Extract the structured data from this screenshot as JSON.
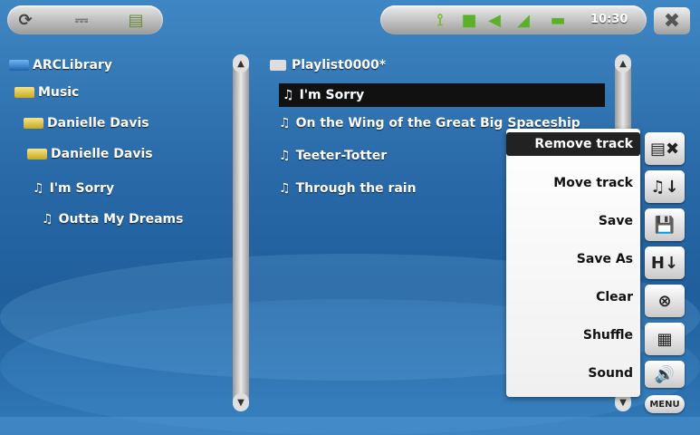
{
  "topbar": {
    "clock": "10:30",
    "icons": [
      "sync-icon",
      "usb-icon",
      "document-icon",
      "antenna-icon",
      "battery-level-icon",
      "speaker-icon",
      "volume-ramp-icon",
      "battery-icon",
      "close-icon"
    ]
  },
  "library": {
    "root": "ARCLibrary",
    "items": [
      {
        "label": "Music",
        "type": "folder"
      },
      {
        "label": "Danielle Davis",
        "type": "folder"
      },
      {
        "label": "Danielle Davis",
        "type": "folder"
      },
      {
        "label": "I'm Sorry",
        "type": "track"
      },
      {
        "label": "Outta My Dreams",
        "type": "track"
      }
    ]
  },
  "playlist": {
    "title": "Playlist0000*",
    "tracks": [
      {
        "label": "I'm Sorry",
        "selected": true
      },
      {
        "label": "On the Wing of the Great Big Spaceship",
        "selected": false
      },
      {
        "label": "Teeter-Totter",
        "selected": false
      },
      {
        "label": "Through the rain",
        "selected": false
      }
    ]
  },
  "menu": {
    "items": [
      "Remove track",
      "Move track",
      "Save",
      "Save As",
      "Clear",
      "Shuffle",
      "Sound"
    ],
    "active": "Remove track",
    "menu_label": "MENU"
  },
  "colors": {
    "background": "#2a6aa8",
    "selection": "#111111",
    "menu_bg": "#ffffff"
  }
}
